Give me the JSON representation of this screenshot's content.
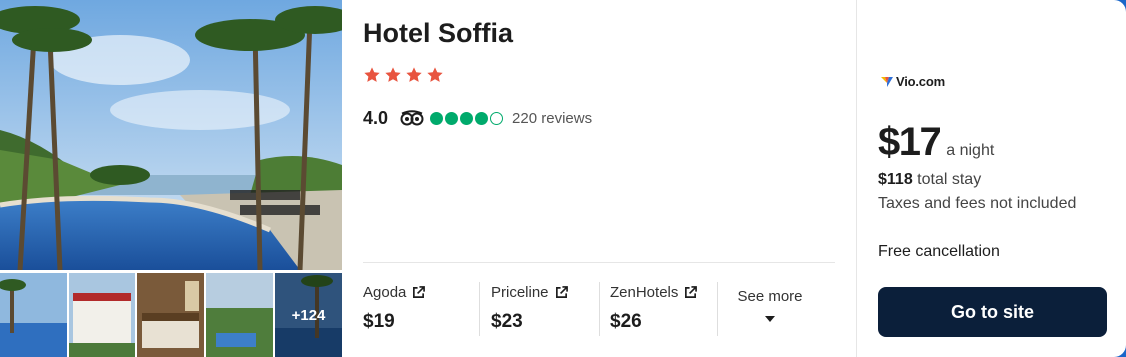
{
  "hotel": {
    "name": "Hotel Soffia",
    "star_count": 4,
    "rating_score": "4.0",
    "bubble_rating": 4,
    "bubble_total": 5,
    "review_count": "220 reviews",
    "photo_more_count": "+124"
  },
  "providers": [
    {
      "name": "Agoda",
      "price": "$19"
    },
    {
      "name": "Priceline",
      "price": "$23"
    },
    {
      "name": "ZenHotels",
      "price": "$26"
    }
  ],
  "see_more_label": "See more",
  "offer": {
    "partner_logo_text": "Vio.com",
    "price": "$17",
    "price_unit": "a night",
    "total_amount": "$118",
    "total_label": "total stay",
    "taxes_note": "Taxes and fees not included",
    "cancellation": "Free cancellation",
    "cta_label": "Go to site"
  },
  "colors": {
    "star": "#e8543f",
    "bubble": "#00aa6c",
    "cta_bg": "#0b1f3a",
    "frame": "#1a66c9"
  },
  "icons": {
    "provider_link": "external-link-icon",
    "see_more": "chevron-down-icon",
    "reviews_source": "tripadvisor-owl-icon"
  }
}
